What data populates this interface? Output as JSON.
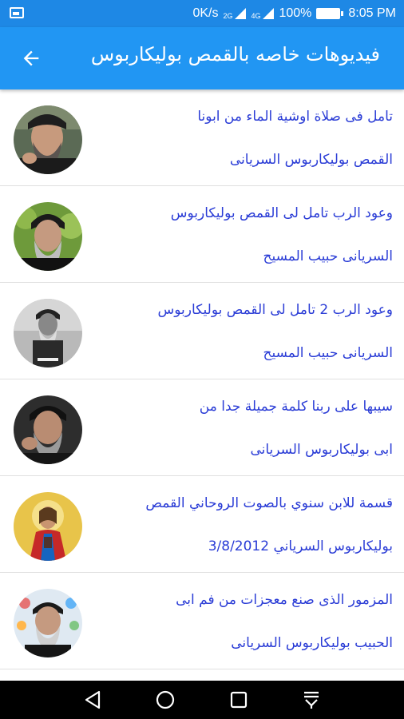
{
  "status_bar": {
    "speed": "0K/s",
    "net1": "2G",
    "net2": "4G",
    "battery": "100%",
    "time": "8:05 PM"
  },
  "app_bar": {
    "title": "فيديوهات خاصه بالقمص بوليكاربوس"
  },
  "items": [
    {
      "line1": "تامل فى صلاة اوشية الماء من ابونا",
      "line2": "القمص بوليكاربوس السريانى",
      "avatar": "priest-portrait"
    },
    {
      "line1": "وعود الرب تامل لى القمص بوليكاربوس",
      "line2": "السريانى حبيب المسيح",
      "avatar": "priest-portrait"
    },
    {
      "line1": "وعود الرب 2 تامل لى القمص بوليكاربوس",
      "line2": "السريانى حبيب المسيح",
      "avatar": "priest-portrait-bw"
    },
    {
      "line1": "سيبها على ربنا كلمة جميلة جدا من",
      "line2": "ابى بوليكاربوس السريانى",
      "avatar": "priest-portrait"
    },
    {
      "line1": "قسمة للابن سنوي بالصوت الروحاني القمص",
      "line2": "بوليكاربوس السرياني 3/8/2012",
      "avatar": "christ-icon"
    },
    {
      "line1": "المزمور الذى صنع معجزات من فم ابى",
      "line2": "الحبيب بوليكاربوس السريانى",
      "avatar": "priest-with-saints"
    }
  ],
  "nav": {
    "back_icon": "triangle-back-icon",
    "home_icon": "circle-home-icon",
    "recents_icon": "square-recents-icon",
    "notification_icon": "pull-down-icon"
  },
  "colors": {
    "status_bar": "#1e88e5",
    "app_bar": "#2196f3",
    "item_text": "#2a3cd6"
  }
}
